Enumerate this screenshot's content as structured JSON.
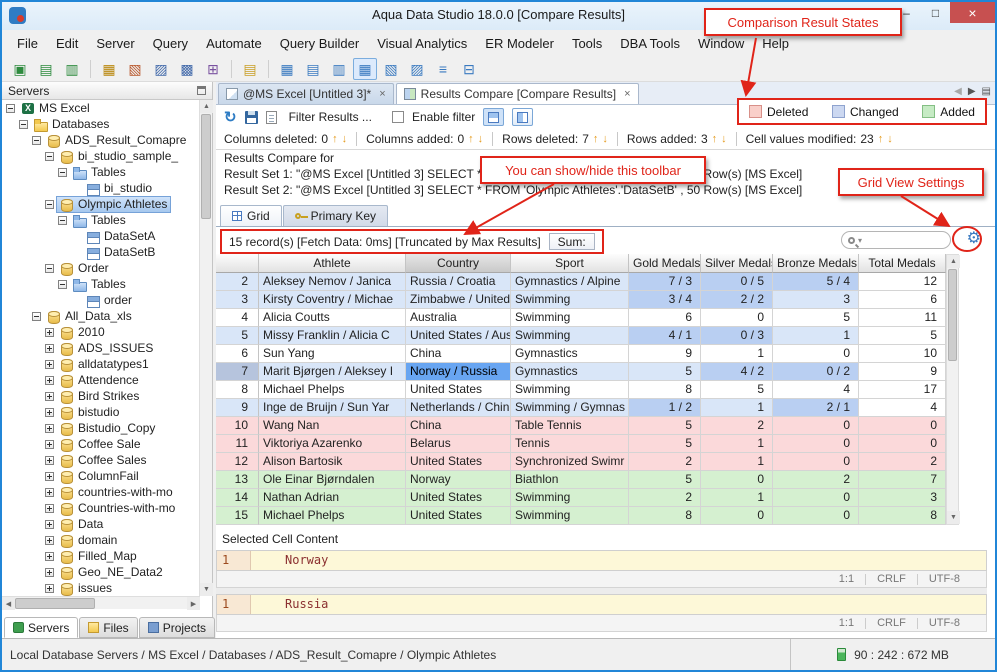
{
  "window": {
    "title": "Aqua Data Studio 18.0.0 [Compare Results]",
    "minimize": "–",
    "maximize": "□",
    "close": "×"
  },
  "menu": {
    "items": [
      "File",
      "Edit",
      "Server",
      "Query",
      "Automate",
      "Query Builder",
      "Visual Analytics",
      "ER Modeler",
      "Tools",
      "DBA Tools",
      "Window",
      "Help"
    ]
  },
  "main_toolbar": {
    "icons": [
      {
        "name": "register-server",
        "glyph": "▣",
        "color": "#2e8b3e"
      },
      {
        "name": "server-properties",
        "glyph": "▤",
        "color": "#2e8b3e"
      },
      {
        "name": "connect-server",
        "glyph": "▥",
        "color": "#2e8b3e"
      },
      {
        "sep": true
      },
      {
        "name": "schema-browser",
        "glyph": "▦",
        "color": "#b8860b"
      },
      {
        "name": "query-analyzer",
        "glyph": "▧",
        "color": "#b8562a"
      },
      {
        "name": "query-builder",
        "glyph": "▨",
        "color": "#4169aa"
      },
      {
        "name": "table-data-editor",
        "glyph": "▩",
        "color": "#4169aa"
      },
      {
        "name": "import-tool",
        "glyph": "⊞",
        "color": "#7a52a0"
      },
      {
        "sep": true
      },
      {
        "name": "open-file",
        "glyph": "▤",
        "color": "#c8a028"
      },
      {
        "sep": true
      },
      {
        "name": "results-grid",
        "glyph": "▦",
        "color": "#3a7ac0"
      },
      {
        "name": "results-text",
        "glyph": "▤",
        "color": "#3a7ac0"
      },
      {
        "name": "results-pivot",
        "glyph": "▥",
        "color": "#3a7ac0"
      },
      {
        "name": "results-compare",
        "glyph": "▦",
        "color": "#3a7ac0",
        "active": true
      },
      {
        "name": "results-chart",
        "glyph": "▧",
        "color": "#3a7ac0"
      },
      {
        "name": "er-diagram",
        "glyph": "▨",
        "color": "#3a7ac0"
      },
      {
        "name": "text-wrap",
        "glyph": "≡",
        "color": "#3a7ac0"
      },
      {
        "name": "auto-fit",
        "glyph": "⊟",
        "color": "#3a7ac0"
      }
    ]
  },
  "doc_tabs": {
    "tabs": [
      {
        "label": "@MS Excel [Untitled 3]*",
        "icon": "query-file",
        "active": false
      },
      {
        "label": "Results Compare [Compare Results]",
        "icon": "compare-results",
        "active": true
      }
    ]
  },
  "legend": {
    "items": [
      {
        "label": "Deleted",
        "color": "#f9cfc9",
        "border": "#d89089"
      },
      {
        "label": "Changed",
        "color": "#ccd8f1",
        "border": "#8fa3cf"
      },
      {
        "label": "Added",
        "color": "#c6ebc4",
        "border": "#84bf84"
      }
    ]
  },
  "compare_toolbar": {
    "filter_label": "Filter Results ...",
    "enable_filter_label": "Enable filter"
  },
  "stats": {
    "items": [
      {
        "label": "Columns deleted:",
        "value": "0"
      },
      {
        "label": "Columns added:",
        "value": "0"
      },
      {
        "label": "Rows deleted:",
        "value": "7"
      },
      {
        "label": "Rows added:",
        "value": "3"
      },
      {
        "label": "Cell values modified:",
        "value": "23"
      }
    ]
  },
  "compare_info": {
    "heading": "Results Compare for",
    "set1": "Result Set 1:  \"@MS Excel [Untitled 3] SELECT * FROM 'Olympic Athletes'.'DataSetA' , 50 Row(s) [MS Excel]",
    "set2": "Result Set 2:  \"@MS Excel [Untitled 3] SELECT * FROM 'Olympic Athletes'.'DataSetB' , 50 Row(s) [MS Excel]"
  },
  "result_tabs": [
    {
      "label": "Grid",
      "icon": "grid",
      "active": true
    },
    {
      "label": "Primary Key",
      "icon": "key",
      "active": false
    }
  ],
  "grid": {
    "status": "15 record(s) [Fetch Data: 0ms]  [Truncated by Max Results]",
    "sum_label": "Sum:",
    "columns": [
      "",
      "Athlete",
      "Country",
      "Sport",
      "Gold Medals",
      "Silver Medals",
      "Bronze Medals",
      "Total Medals"
    ],
    "selected_column": 2,
    "rows": [
      {
        "num": "2",
        "state": "changed",
        "cells": {
          "athlete": "Aleksey Nemov / Janica",
          "country": "Russia / Croatia",
          "sport": "Gymnastics / Alpine",
          "gold": "7 / 3",
          "silver": "0 / 5",
          "bronze": "5 / 4",
          "total": "12"
        }
      },
      {
        "num": "3",
        "state": "changed",
        "cells": {
          "athlete": "Kirsty Coventry / Michae",
          "country": "Zimbabwe / United",
          "sport": "Swimming",
          "gold": "3 / 4",
          "silver": "2 / 2",
          "bronze": "3",
          "total": "6"
        }
      },
      {
        "num": "4",
        "state": "normal",
        "cells": {
          "athlete": "Alicia Coutts",
          "country": "Australia",
          "sport": "Swimming",
          "gold": "6",
          "silver": "0",
          "bronze": "5",
          "total": "11"
        }
      },
      {
        "num": "5",
        "state": "changed",
        "cells": {
          "athlete": "Missy Franklin / Alicia C",
          "country": "United States / Aus",
          "sport": "Swimming",
          "gold": "4 / 1",
          "silver": "0 / 3",
          "bronze": "1",
          "total": "5"
        }
      },
      {
        "num": "6",
        "state": "normal",
        "cells": {
          "athlete": "Sun Yang",
          "country": "China",
          "sport": "Gymnastics",
          "gold": "9",
          "silver": "1",
          "bronze": "0",
          "total": "10"
        }
      },
      {
        "num": "7",
        "state": "changed",
        "selected_cell": "country",
        "cells": {
          "athlete": "Marit Bjørgen / Aleksey I",
          "country": "Norway / Russia",
          "sport": "Gymnastics",
          "gold": "5",
          "silver": "4 / 2",
          "bronze": "0 / 2",
          "total": "9"
        }
      },
      {
        "num": "8",
        "state": "normal",
        "cells": {
          "athlete": "Michael Phelps",
          "country": "United States",
          "sport": "Swimming",
          "gold": "8",
          "silver": "5",
          "bronze": "4",
          "total": "17"
        }
      },
      {
        "num": "9",
        "state": "changed",
        "cells": {
          "athlete": "Inge de Bruijn / Sun Yar",
          "country": "Netherlands / Chin",
          "sport": "Swimming / Gymnas",
          "gold": "1 / 2",
          "silver": "1",
          "bronze": "2 / 1",
          "total": "4"
        }
      },
      {
        "num": "10",
        "state": "deleted",
        "cells": {
          "athlete": "Wang Nan",
          "country": "China",
          "sport": "Table Tennis",
          "gold": "5",
          "silver": "2",
          "bronze": "0",
          "total": "0"
        }
      },
      {
        "num": "11",
        "state": "deleted",
        "cells": {
          "athlete": "Viktoriya Azarenko",
          "country": "Belarus",
          "sport": "Tennis",
          "gold": "5",
          "silver": "1",
          "bronze": "0",
          "total": "0"
        }
      },
      {
        "num": "12",
        "state": "deleted",
        "cells": {
          "athlete": "Alison Bartosik",
          "country": "United States",
          "sport": "Synchronized Swimr",
          "gold": "2",
          "silver": "1",
          "bronze": "0",
          "total": "2"
        }
      },
      {
        "num": "13",
        "state": "added",
        "cells": {
          "athlete": "Ole Einar Bjørndalen",
          "country": "Norway",
          "sport": "Biathlon",
          "gold": "5",
          "silver": "0",
          "bronze": "2",
          "total": "7"
        }
      },
      {
        "num": "14",
        "state": "added",
        "cells": {
          "athlete": "Nathan Adrian",
          "country": "United States",
          "sport": "Swimming",
          "gold": "2",
          "silver": "1",
          "bronze": "0",
          "total": "3"
        }
      },
      {
        "num": "15",
        "state": "added",
        "cells": {
          "athlete": "Michael Phelps",
          "country": "United States",
          "sport": "Swimming",
          "gold": "8",
          "silver": "0",
          "bronze": "0",
          "total": "8"
        }
      }
    ]
  },
  "cell_content": {
    "heading": "Selected Cell Content",
    "viewers": [
      {
        "line": "1",
        "text": "Norway",
        "position": "1:1",
        "eol": "CRLF",
        "encoding": "UTF-8"
      },
      {
        "line": "1",
        "text": "Russia",
        "position": "1:1",
        "eol": "CRLF",
        "encoding": "UTF-8"
      }
    ]
  },
  "sidebar": {
    "title": "Servers",
    "tree": [
      {
        "label": "MS Excel",
        "depth": 0,
        "icon": "excel",
        "toggle": "open"
      },
      {
        "label": "Databases",
        "depth": 1,
        "icon": "folder",
        "toggle": "open"
      },
      {
        "label": "ADS_Result_Comapre",
        "depth": 2,
        "icon": "db",
        "toggle": "open"
      },
      {
        "label": "bi_studio_sample_",
        "depth": 3,
        "icon": "db",
        "toggle": "open"
      },
      {
        "label": "Tables",
        "depth": 4,
        "icon": "folder-blue",
        "toggle": "open"
      },
      {
        "label": "bi_studio",
        "depth": 5,
        "icon": "table",
        "toggle": "none"
      },
      {
        "label": "Olympic Athletes",
        "depth": 3,
        "icon": "db",
        "toggle": "open",
        "selected": true
      },
      {
        "label": "Tables",
        "depth": 4,
        "icon": "folder-blue",
        "toggle": "open"
      },
      {
        "label": "DataSetA",
        "depth": 5,
        "icon": "table",
        "toggle": "none"
      },
      {
        "label": "DataSetB",
        "depth": 5,
        "icon": "table",
        "toggle": "none"
      },
      {
        "label": "Order",
        "depth": 3,
        "icon": "db",
        "toggle": "open"
      },
      {
        "label": "Tables",
        "depth": 4,
        "icon": "folder-blue",
        "toggle": "open"
      },
      {
        "label": "order",
        "depth": 5,
        "icon": "table",
        "toggle": "none"
      },
      {
        "label": "All_Data_xls",
        "depth": 2,
        "icon": "db",
        "toggle": "open"
      },
      {
        "label": "2010",
        "depth": 3,
        "icon": "db",
        "toggle": "closed"
      },
      {
        "label": "ADS_ISSUES",
        "depth": 3,
        "icon": "db",
        "toggle": "closed"
      },
      {
        "label": "alldatatypes1",
        "depth": 3,
        "icon": "db",
        "toggle": "closed"
      },
      {
        "label": "Attendence",
        "depth": 3,
        "icon": "db",
        "toggle": "closed"
      },
      {
        "label": "Bird Strikes",
        "depth": 3,
        "icon": "db",
        "toggle": "closed"
      },
      {
        "label": "bistudio",
        "depth": 3,
        "icon": "db",
        "toggle": "closed"
      },
      {
        "label": "Bistudio_Copy",
        "depth": 3,
        "icon": "db",
        "toggle": "closed"
      },
      {
        "label": "Coffee Sale",
        "depth": 3,
        "icon": "db",
        "toggle": "closed"
      },
      {
        "label": "Coffee Sales",
        "depth": 3,
        "icon": "db",
        "toggle": "closed"
      },
      {
        "label": "ColumnFail",
        "depth": 3,
        "icon": "db",
        "toggle": "closed"
      },
      {
        "label": "countries-with-mo",
        "depth": 3,
        "icon": "db",
        "toggle": "closed"
      },
      {
        "label": "Countries-with-mo",
        "depth": 3,
        "icon": "db",
        "toggle": "closed"
      },
      {
        "label": "Data",
        "depth": 3,
        "icon": "db",
        "toggle": "closed"
      },
      {
        "label": "domain",
        "depth": 3,
        "icon": "db",
        "toggle": "closed"
      },
      {
        "label": "Filled_Map",
        "depth": 3,
        "icon": "db",
        "toggle": "closed"
      },
      {
        "label": "Geo_NE_Data2",
        "depth": 3,
        "icon": "db",
        "toggle": "closed"
      },
      {
        "label": "issues",
        "depth": 3,
        "icon": "db",
        "toggle": "closed"
      }
    ],
    "tabs": [
      {
        "label": "Servers",
        "icon": "servers",
        "active": true
      },
      {
        "label": "Files",
        "icon": "files",
        "active": false
      },
      {
        "label": "Projects",
        "icon": "projects",
        "active": false
      }
    ]
  },
  "status_bar": {
    "breadcrumb": "Local Database Servers / MS Excel / Databases / ADS_Result_Comapre / Olympic Athletes",
    "memory": "90 : 242 : 672 MB"
  },
  "callouts": {
    "states": "Comparison Result States",
    "toolbar": "You can show/hide this toolbar",
    "grid_settings": "Grid View Settings"
  },
  "glyphs": {
    "close_tab": "×",
    "up": "↑",
    "down": "↓",
    "back": "◀",
    "forward": "▶",
    "tab_list": "▤",
    "refresh": "↻",
    "dropdown": "▾",
    "gear": "⚙",
    "scroll_up": "▲",
    "scroll_down": "▼",
    "scroll_left": "◀",
    "scroll_right": "▶"
  }
}
